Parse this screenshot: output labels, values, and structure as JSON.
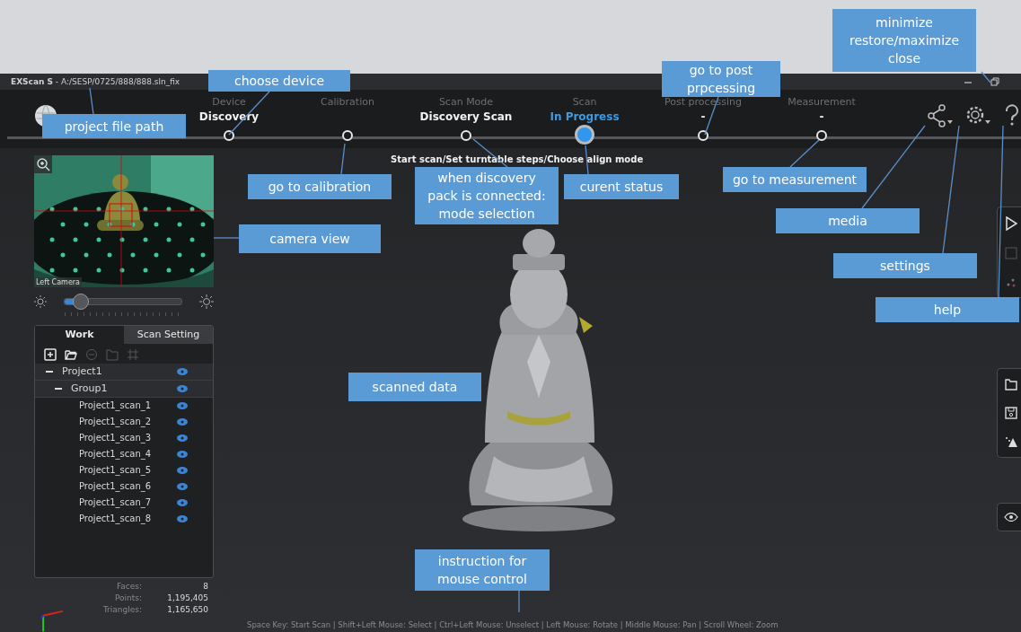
{
  "window": {
    "title": "**EXScan S** - A:/SESP/0725/888/888.sln_fix"
  },
  "steps": [
    {
      "label": "Device",
      "value": "Discovery",
      "selected": false
    },
    {
      "label": "Calibration",
      "selected": false
    },
    {
      "label": "Scan Mode",
      "value": "Discovery Scan",
      "selected": false
    },
    {
      "label": "Scan",
      "value": "In Progress",
      "selected": true
    },
    {
      "label": "Post processing",
      "value": "-",
      "selected": false
    },
    {
      "label": "Measurement",
      "value": "-",
      "selected": false
    }
  ],
  "step_hint": "Start scan/Set turntable steps/Choose align mode",
  "camera": {
    "label": "Left Camera"
  },
  "brightness": {
    "level": 0.12
  },
  "tabs": [
    {
      "label": "Work",
      "selected": true
    },
    {
      "label": "Scan Setting",
      "selected": false
    }
  ],
  "tools": [
    {
      "kind": "add",
      "disabled": false
    },
    {
      "kind": "open",
      "disabled": false
    },
    {
      "kind": "remove",
      "disabled": true
    },
    {
      "kind": "folder",
      "disabled": true
    },
    {
      "kind": "grid",
      "disabled": true
    }
  ],
  "tree": [
    {
      "label": "Project1",
      "expanded": true,
      "visible": true,
      "children": [
        {
          "label": "Group1",
          "expanded": true,
          "visible": true,
          "children": [
            {
              "label": "Project1_scan_1",
              "visible": true
            },
            {
              "label": "Project1_scan_2",
              "visible": true
            },
            {
              "label": "Project1_scan_3",
              "visible": true
            },
            {
              "label": "Project1_scan_4",
              "visible": true
            },
            {
              "label": "Project1_scan_5",
              "visible": true
            },
            {
              "label": "Project1_scan_6",
              "visible": true
            },
            {
              "label": "Project1_scan_7",
              "visible": true
            },
            {
              "label": "Project1_scan_8",
              "visible": true
            }
          ]
        }
      ]
    }
  ],
  "stats": [
    {
      "label": "Faces:",
      "value": "8"
    },
    {
      "label": "Points:",
      "value": "1,195,405"
    },
    {
      "label": "Triangles:",
      "value": "1,165,650"
    }
  ],
  "status_bar": "Space Key: Start Scan | Shift+Left Mouse: Select | Ctrl+Left Mouse: Unselect | Left Mouse: Rotate | Middle Mouse: Pan | Scroll Wheel: Zoom",
  "annotations": [
    {
      "lines": [
        "minimize",
        "restore/maximize",
        "close"
      ]
    },
    {
      "lines": [
        "choose device"
      ]
    },
    {
      "lines": [
        "go to post",
        "prpcessing"
      ]
    },
    {
      "lines": [
        "project file path"
      ]
    },
    {
      "lines": [
        "go to calibration"
      ]
    },
    {
      "lines": [
        "when discovery",
        "pack is connected:",
        "mode selection"
      ]
    },
    {
      "lines": [
        "curent status"
      ]
    },
    {
      "lines": [
        "go to measurement"
      ]
    },
    {
      "lines": [
        "media"
      ]
    },
    {
      "lines": [
        "camera view"
      ]
    },
    {
      "lines": [
        "settings"
      ]
    },
    {
      "lines": [
        "help"
      ]
    },
    {
      "lines": [
        "scanned data"
      ]
    },
    {
      "lines": [
        "instruction for",
        "mouse control"
      ]
    }
  ]
}
